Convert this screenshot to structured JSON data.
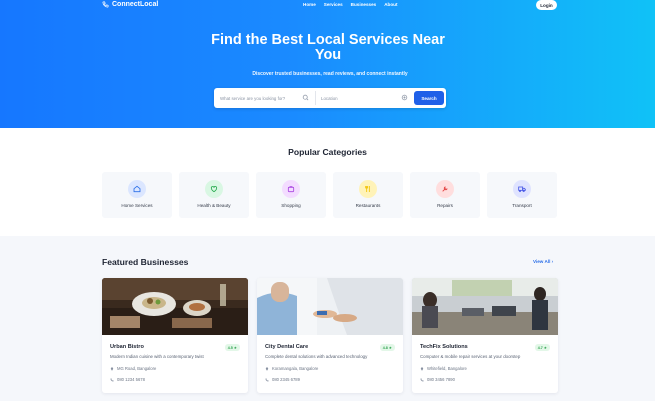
{
  "brand": {
    "name": "ConnectLocal"
  },
  "nav": {
    "items": [
      "Home",
      "Services",
      "Businesses",
      "About"
    ],
    "login_label": "Login"
  },
  "hero": {
    "title": "Find the Best Local Services Near You",
    "subtitle": "Discover trusted businesses, read reviews, and connect instantly",
    "search_placeholder": "What service are you looking for?",
    "location_placeholder": "Location",
    "search_button": "Search"
  },
  "categories": {
    "title": "Popular Categories",
    "items": [
      {
        "label": "Home Services",
        "icon": "home-icon",
        "color": "#dbe6ff"
      },
      {
        "label": "Health & Beauty",
        "icon": "heart-icon",
        "color": "#d9f7e3"
      },
      {
        "label": "Shopping",
        "icon": "shopping-bag-icon",
        "color": "#f3dcff"
      },
      {
        "label": "Restaurants",
        "icon": "restaurant-icon",
        "color": "#fff3b8"
      },
      {
        "label": "Repairs",
        "icon": "wrench-icon",
        "color": "#ffdede"
      },
      {
        "label": "Transport",
        "icon": "truck-icon",
        "color": "#dfe3ff"
      }
    ]
  },
  "featured": {
    "title": "Featured Businesses",
    "view_all": "View All",
    "cards": [
      {
        "name": "Urban Bistro",
        "rating": "4.5 ★",
        "description": "Modern Indian cuisine with a contemporary twist",
        "address": "MG Road, Bangalore",
        "phone": "080 1234 5678"
      },
      {
        "name": "City Dental Care",
        "rating": "4.8 ★",
        "description": "Complete dental solutions with advanced technology",
        "address": "Koramangala, Bangalore",
        "phone": "080 2345 6789"
      },
      {
        "name": "TechFix Solutions",
        "rating": "4.7 ★",
        "description": "Computer & mobile repair services at your doorstep",
        "address": "Whitefield, Bangalore",
        "phone": "080 3456 7890"
      }
    ]
  },
  "colors": {
    "hero_start": "#1677ff",
    "hero_end": "#10c2f7",
    "accent": "#2060e8",
    "rating_green": "#26a048"
  }
}
